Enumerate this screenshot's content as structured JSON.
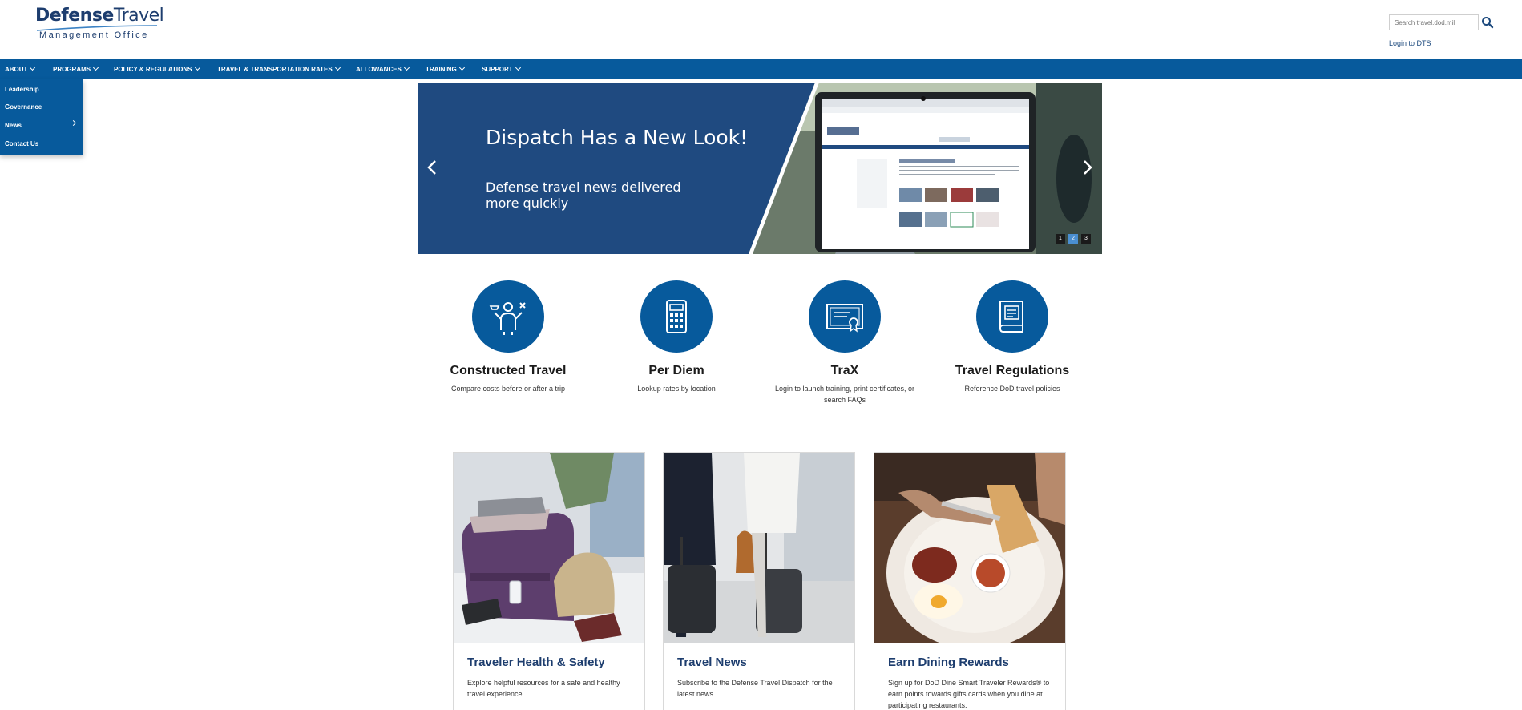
{
  "header": {
    "logo_main_bold": "Defense",
    "logo_main_light": "Travel",
    "logo_sub": "Management Office",
    "search_placeholder": "Search travel.dod.mil",
    "login_label": "Login to DTS"
  },
  "nav": {
    "items": [
      {
        "label": "ABOUT"
      },
      {
        "label": "PROGRAMS"
      },
      {
        "label": "POLICY & REGULATIONS"
      },
      {
        "label": "TRAVEL & TRANSPORTATION RATES"
      },
      {
        "label": "ALLOWANCES"
      },
      {
        "label": "TRAINING"
      },
      {
        "label": "SUPPORT"
      }
    ],
    "about_dropdown": [
      "Leadership",
      "Governance",
      "News",
      "Contact Us"
    ]
  },
  "carousel": {
    "title": "Dispatch Has a New Look!",
    "subtitle": "Defense travel news delivered more quickly",
    "dots": [
      "1",
      "2",
      "3"
    ],
    "active_dot": 2
  },
  "quick_links": [
    {
      "title": "Constructed Travel",
      "desc": "Compare costs before or after a trip",
      "icon": "traveler-icon"
    },
    {
      "title": "Per Diem",
      "desc": "Lookup rates by location",
      "icon": "calculator-icon"
    },
    {
      "title": "TraX",
      "desc": "Login to launch training, print certificates, or search FAQs",
      "icon": "certificate-icon"
    },
    {
      "title": "Travel Regulations",
      "desc": "Reference DoD travel policies",
      "icon": "book-icon"
    }
  ],
  "cards": [
    {
      "title": "Traveler Health & Safety",
      "desc": "Explore helpful resources for a safe and healthy travel experience."
    },
    {
      "title": "Travel News",
      "desc": "Subscribe to the Defense Travel Dispatch for the latest news."
    },
    {
      "title": "Earn Dining Rewards",
      "desc": "Sign up for DoD Dine Smart Traveler Rewards® to earn points towards gifts cards when you dine at participating restaurants."
    }
  ],
  "colors": {
    "brand_blue": "#075a9c",
    "navy": "#1d3d6e",
    "banner_blue": "#1f4a80"
  }
}
